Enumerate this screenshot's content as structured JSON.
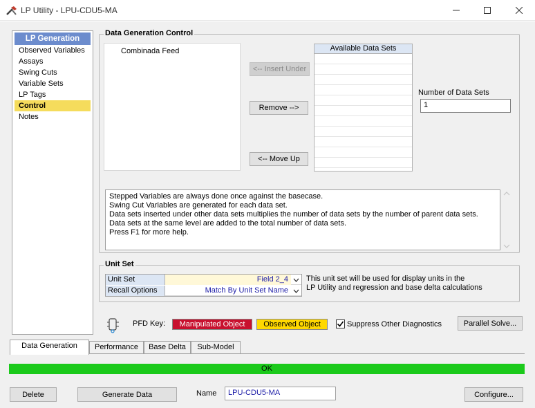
{
  "window": {
    "title": "LP Utility - LPU-CDU5-MA"
  },
  "nav": {
    "header": "LP Generation",
    "items": [
      {
        "label": "Observed Variables"
      },
      {
        "label": "Assays"
      },
      {
        "label": "Swing Cuts"
      },
      {
        "label": "Variable Sets"
      },
      {
        "label": "LP Tags"
      },
      {
        "label": "Control"
      },
      {
        "label": "Notes"
      }
    ],
    "selected_index": 5
  },
  "data_gen": {
    "title": "Data Generation Control",
    "tree_item": "Combinada Feed",
    "insert_under": "<-- Insert Under",
    "remove": "Remove -->",
    "move_up": "<-- Move Up",
    "available_header": "Available Data Sets",
    "num_label": "Number of Data Sets",
    "num_value": "1",
    "help_lines": [
      "Stepped Variables are always done once against the basecase.",
      "Swing Cut Variables are generated for each data set.",
      "Data sets inserted under other data sets multiplies the number of data sets by the number of parent data sets.",
      "Data sets at the same level are added to the total number of data sets.",
      "Press F1 for more help."
    ]
  },
  "unit_set": {
    "title": "Unit Set",
    "rows": [
      {
        "label": "Unit Set",
        "value": "Field 2_4"
      },
      {
        "label": "Recall Options",
        "value": "Match By Unit Set Name"
      }
    ],
    "note_line1": "This unit set will be used for display units in the",
    "note_line2": "LP Utility and regression and base delta calculations"
  },
  "pfd": {
    "key_label": "PFD Key:",
    "manipulated": "Manipulated Object",
    "observed": "Observed Object",
    "suppress": "Suppress Other Diagnostics",
    "parallel": "Parallel Solve...",
    "colors": {
      "manipulated": "#c8102e",
      "observed": "#ffd800"
    }
  },
  "tabs": [
    {
      "label": "Data Generation"
    },
    {
      "label": "Performance"
    },
    {
      "label": "Base Delta"
    },
    {
      "label": "Sub-Model"
    }
  ],
  "status": {
    "text": "OK",
    "color": "#1bca1b"
  },
  "footer": {
    "delete": "Delete",
    "generate": "Generate Data",
    "name_label": "Name",
    "name_value": "LPU-CDU5-MA",
    "configure": "Configure..."
  }
}
